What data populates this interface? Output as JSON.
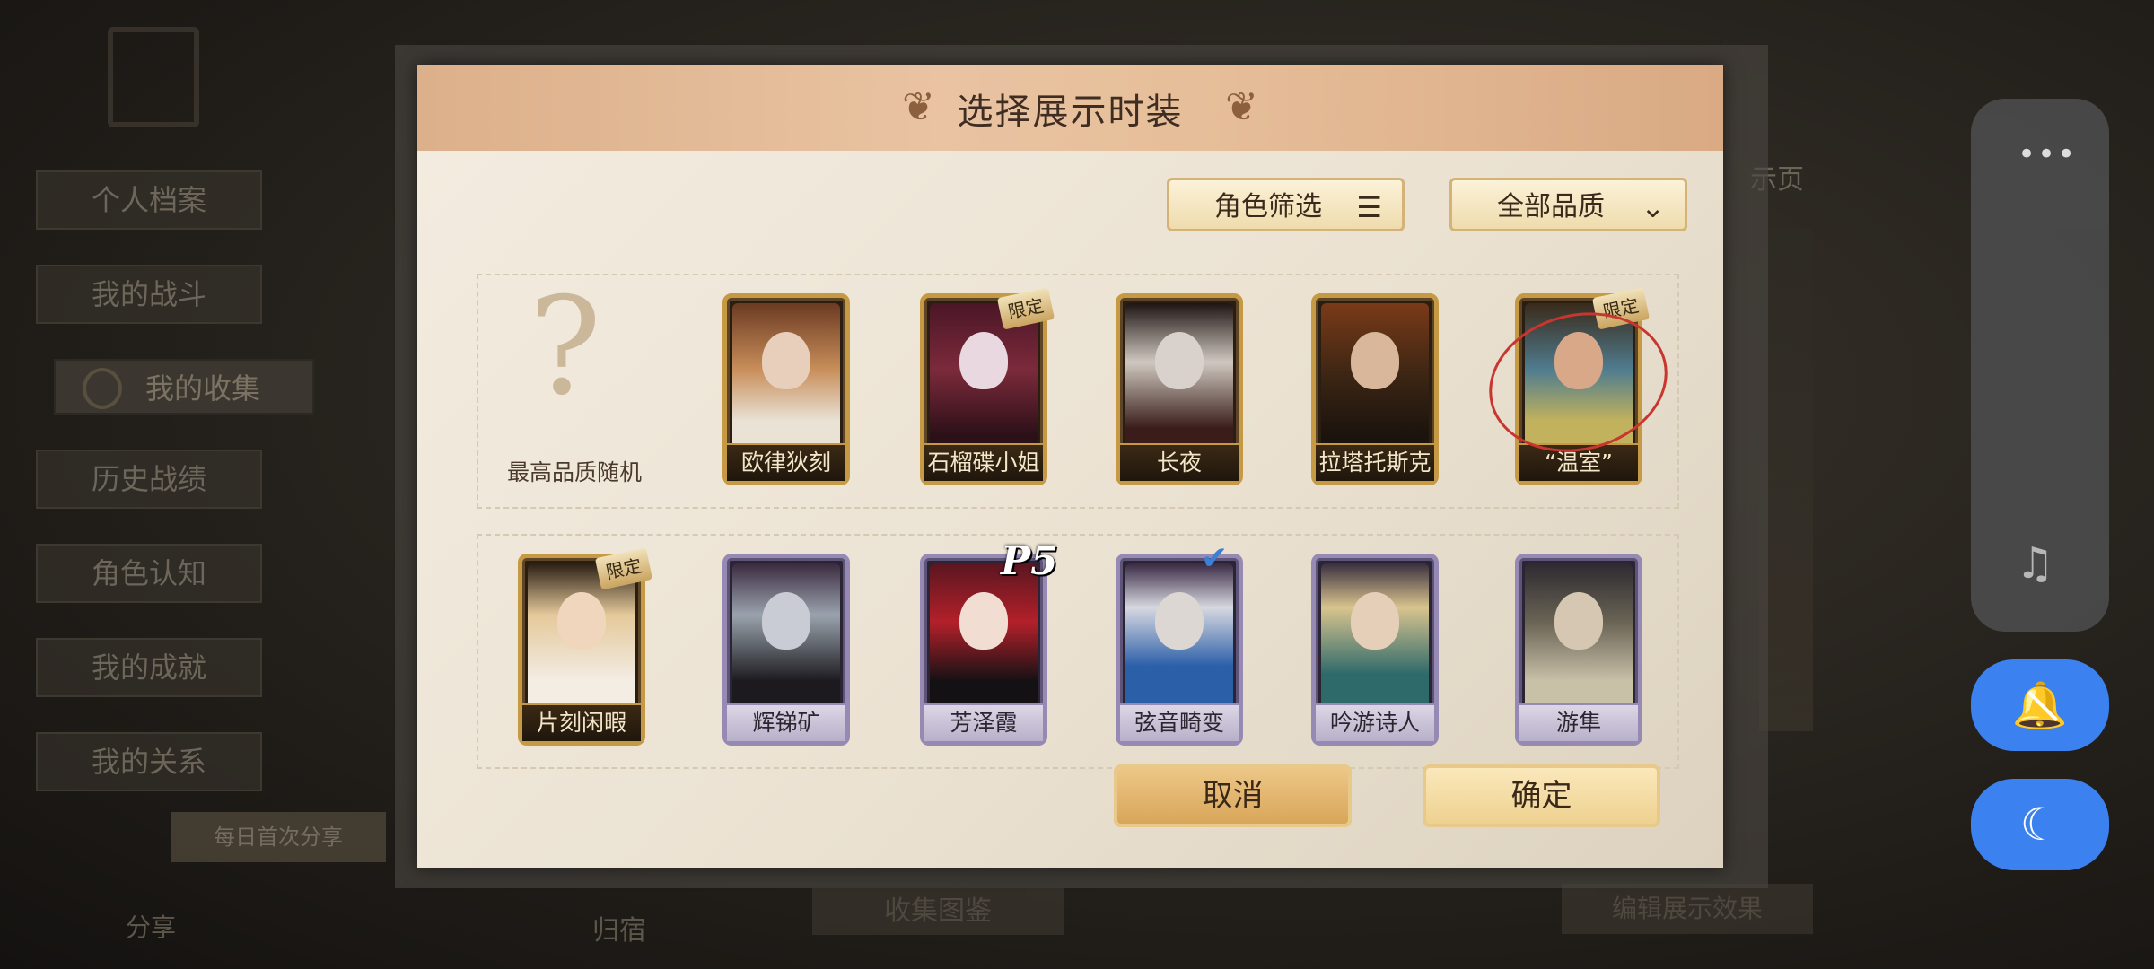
{
  "sidebar": {
    "items": [
      "个人档案",
      "我的战斗",
      "我的收集",
      "历史战绩",
      "角色认知",
      "我的成就",
      "我的关系"
    ],
    "active_index": 2
  },
  "background": {
    "share_banner": "每日首次分享",
    "share_label": "分享",
    "home_label": "归宿",
    "collect_label": "收集图鉴",
    "edit_label": "编辑展示效果",
    "right_peek": "示页"
  },
  "dialog": {
    "title": "选择展示时装",
    "filter_role": "角色筛选",
    "filter_quality": "全部品质",
    "random_label": "最高品质随机",
    "row1": [
      {
        "name": "欧律狄刻",
        "badge": ""
      },
      {
        "name": "石榴碟小姐",
        "badge": "限定"
      },
      {
        "name": "长夜",
        "badge": ""
      },
      {
        "name": "拉塔托斯克",
        "badge": ""
      },
      {
        "name": "“温室”",
        "badge": "限定"
      }
    ],
    "row2": [
      {
        "name": "片刻闲暇",
        "badge": "限定"
      },
      {
        "name": "辉锑矿",
        "badge": ""
      },
      {
        "name": "芳泽霞",
        "badge": ""
      },
      {
        "name": "弦音畸变",
        "badge": ""
      },
      {
        "name": "吟游诗人",
        "badge": ""
      },
      {
        "name": "游隼",
        "badge": ""
      }
    ],
    "p5_logo": "P5",
    "cancel": "取消",
    "confirm": "确定"
  },
  "float_panel": {
    "more": "•••"
  },
  "colors": {
    "accent": "#3b82f0",
    "gold": "#c69a45",
    "purple": "#9689b4"
  }
}
